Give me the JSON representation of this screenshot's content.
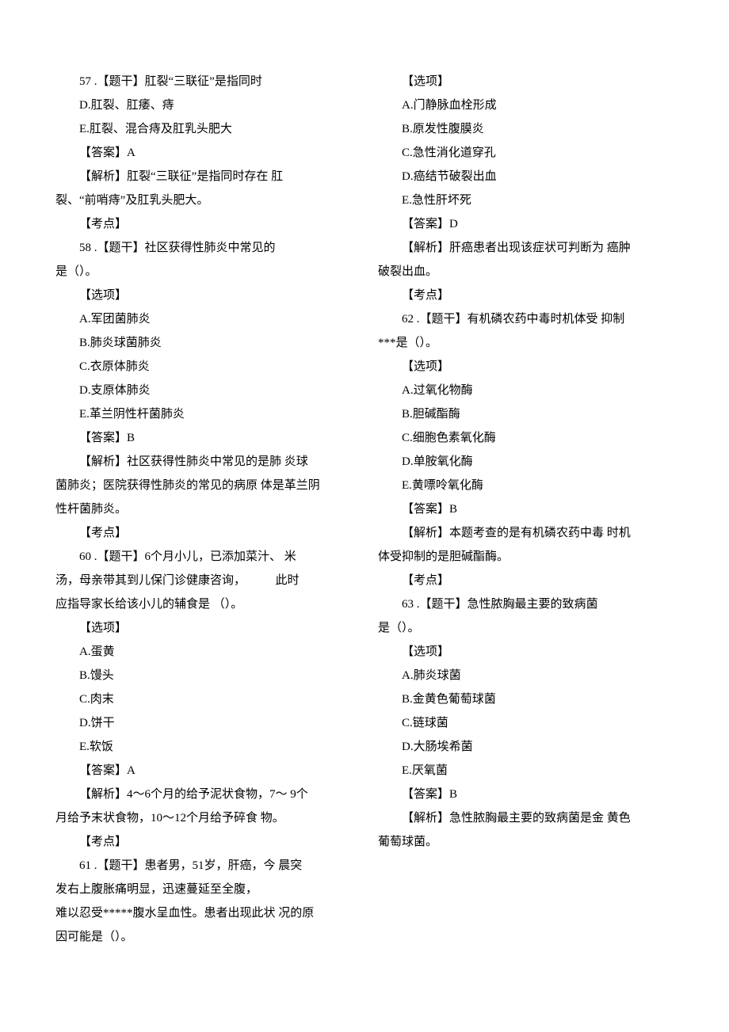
{
  "page": {
    "lines": [
      {
        "t": "57 .【题干】肛裂“三联征”是指同时",
        "cls": "line"
      },
      {
        "t": "D.肛裂、肛痿、痔",
        "cls": "line"
      },
      {
        "t": "E.肛裂、混合痔及肛乳头肥大",
        "cls": "line"
      },
      {
        "t": "【答案】A",
        "cls": "line"
      },
      {
        "t": "【解析】肛裂“三联征”是指同时存在 肛",
        "cls": "line"
      },
      {
        "t": "裂、“前哨痔”及肛乳头肥大。",
        "cls": "line-noindent"
      },
      {
        "t": "【考点】",
        "cls": "line"
      },
      {
        "t": "58 .【题干】社区获得性肺炎中常见的",
        "cls": "line"
      },
      {
        "t": "是（）。",
        "cls": "line-noindent"
      },
      {
        "t": "【选项】",
        "cls": "line"
      },
      {
        "t": "A.军团菌肺炎",
        "cls": "line"
      },
      {
        "t": "B.肺炎球菌肺炎",
        "cls": "line"
      },
      {
        "t": "C.衣原体肺炎",
        "cls": "line"
      },
      {
        "t": "D.支原体肺炎",
        "cls": "line"
      },
      {
        "t": "E.革兰阴性杆菌肺炎",
        "cls": "line"
      },
      {
        "t": "【答案】B",
        "cls": "line"
      },
      {
        "t": "【解析】社区获得性肺炎中常见的是肺 炎球",
        "cls": "line"
      },
      {
        "t": "菌肺炎；医院获得性肺炎的常见的病原 体是革兰阴",
        "cls": "line-noindent"
      },
      {
        "t": "性杆菌肺炎。",
        "cls": "line-noindent"
      },
      {
        "t": "【考点】",
        "cls": "line"
      },
      {
        "t": "60 .【题干】6个月小儿，已添加菜汁、 米",
        "cls": "line"
      },
      {
        "t": "汤，母亲带其到儿保门诊健康咨询，          此时",
        "cls": "line-noindent"
      },
      {
        "t": "应指导家长给该小儿的辅食是 （）。",
        "cls": "line-noindent"
      },
      {
        "t": "【选项】",
        "cls": "line"
      },
      {
        "t": "A.蛋黄",
        "cls": "line"
      },
      {
        "t": "B.馒头",
        "cls": "line"
      },
      {
        "t": "C.肉末",
        "cls": "line"
      },
      {
        "t": "D.饼干",
        "cls": "line"
      },
      {
        "t": "E.软饭",
        "cls": "line"
      },
      {
        "t": "【答案】A",
        "cls": "line"
      },
      {
        "t": "【解析】4～6个月的给予泥状食物，7～ 9个",
        "cls": "line"
      },
      {
        "t": "月给予末状食物，10～12个月给予碎食 物。",
        "cls": "line-noindent"
      },
      {
        "t": "【考点】",
        "cls": "line"
      },
      {
        "t": "61 .【题干】患者男，51岁，肝癌，今 晨突",
        "cls": "line"
      },
      {
        "t": "发右上腹胀痛明显，迅速蔓延至全腹，",
        "cls": "line-noindent"
      },
      {
        "t": "难以忍受*****腹水呈血性。患者出现此状 况的原",
        "cls": "line-noindent"
      },
      {
        "t": "因可能是（）。",
        "cls": "line-noindent"
      },
      {
        "t": "【选项】",
        "cls": "line"
      },
      {
        "t": "A.门静脉血栓形成",
        "cls": "line"
      },
      {
        "t": "B.原发性腹膜炎",
        "cls": "line"
      },
      {
        "t": "C.急性消化道穿孔",
        "cls": "line"
      },
      {
        "t": "D.癌结节破裂出血",
        "cls": "line"
      },
      {
        "t": "E.急性肝坏死",
        "cls": "line"
      },
      {
        "t": "【答案】D",
        "cls": "line"
      },
      {
        "t": "【解析】肝癌患者出现该症状可判断为 癌肿",
        "cls": "line"
      },
      {
        "t": "破裂出血。",
        "cls": "line-noindent"
      },
      {
        "t": "【考点】",
        "cls": "line"
      },
      {
        "t": "62 .【题干】有机磷农药中毒时机体受 抑制",
        "cls": "line"
      },
      {
        "t": "***是（）。",
        "cls": "line-noindent"
      },
      {
        "t": "【选项】",
        "cls": "line"
      },
      {
        "t": "A.过氧化物酶",
        "cls": "line"
      },
      {
        "t": "B.胆碱酯酶",
        "cls": "line"
      },
      {
        "t": "C.细胞色素氧化酶",
        "cls": "line"
      },
      {
        "t": "D.单胺氧化酶",
        "cls": "line"
      },
      {
        "t": "E.黄嘌呤氧化酶",
        "cls": "line"
      },
      {
        "t": "【答案】B",
        "cls": "line"
      },
      {
        "t": "【解析】本题考查的是有机磷农药中毒 时机",
        "cls": "line"
      },
      {
        "t": "体受抑制的是胆碱酯酶。",
        "cls": "line-noindent"
      },
      {
        "t": "【考点】",
        "cls": "line"
      },
      {
        "t": "63 .【题干】急性脓胸最主要的致病菌",
        "cls": "line"
      },
      {
        "t": "是（）。",
        "cls": "line-noindent"
      },
      {
        "t": "【选项】",
        "cls": "line"
      },
      {
        "t": "A.肺炎球菌",
        "cls": "line"
      },
      {
        "t": "B.金黄色葡萄球菌",
        "cls": "line"
      },
      {
        "t": "C.链球菌",
        "cls": "line"
      },
      {
        "t": "D.大肠埃希菌",
        "cls": "line"
      },
      {
        "t": "E.厌氧菌",
        "cls": "line"
      },
      {
        "t": "【答案】B",
        "cls": "line"
      },
      {
        "t": "【解析】急性脓胸最主要的致病菌是金 黄色",
        "cls": "line"
      },
      {
        "t": "葡萄球菌。",
        "cls": "line-noindent"
      }
    ]
  }
}
